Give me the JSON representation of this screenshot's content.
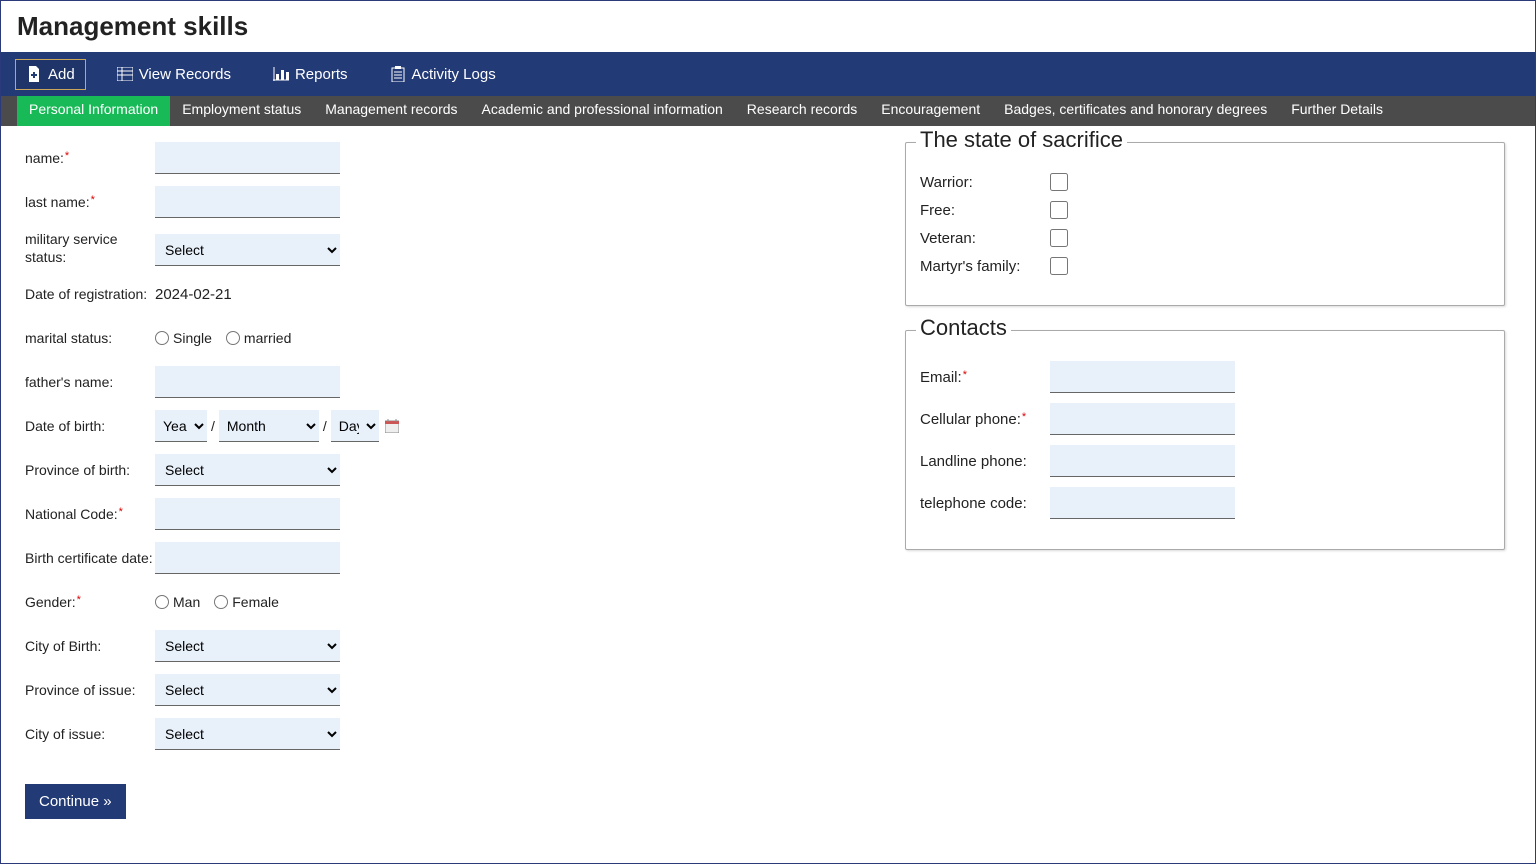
{
  "pageTitle": "Management skills",
  "topbar": {
    "add": "Add",
    "viewRecords": "View Records",
    "reports": "Reports",
    "activityLogs": "Activity Logs"
  },
  "tabs": {
    "personal": "Personal Information",
    "employment": "Employment status",
    "management": "Management records",
    "academic": "Academic and professional information",
    "research": "Research records",
    "encouragement": "Encouragement",
    "badges": "Badges, certificates and honorary degrees",
    "further": "Further Details"
  },
  "labels": {
    "name": "name:",
    "lastName": "last name:",
    "militaryStatus": "military service status:",
    "dateOfReg": "Date of registration:",
    "maritalStatus": "marital status:",
    "fathersName": "father's name:",
    "dateOfBirth": "Date of birth:",
    "provinceOfBirth": "Province of birth:",
    "nationalCode": "National Code:",
    "birthCertDate": "Birth certificate date:",
    "gender": "Gender:",
    "cityOfBirth": "City of Birth:",
    "provinceOfIssue": "Province of issue:",
    "cityOfIssue": "City of issue:"
  },
  "values": {
    "dateOfReg": "2024-02-21",
    "selectPlaceholder": "Select",
    "year": "Year",
    "month": "Month",
    "day": "Day",
    "single": "Single",
    "married": "married",
    "man": "Man",
    "female": "Female"
  },
  "continueBtn": "Continue »",
  "sacrifice": {
    "title": "The state of sacrifice",
    "warrior": "Warrior:",
    "free": "Free:",
    "veteran": "Veteran:",
    "martyr": "Martyr's family:"
  },
  "contacts": {
    "title": "Contacts",
    "email": "Email:",
    "cell": "Cellular phone:",
    "landline": "Landline phone:",
    "telCode": "telephone code:"
  }
}
